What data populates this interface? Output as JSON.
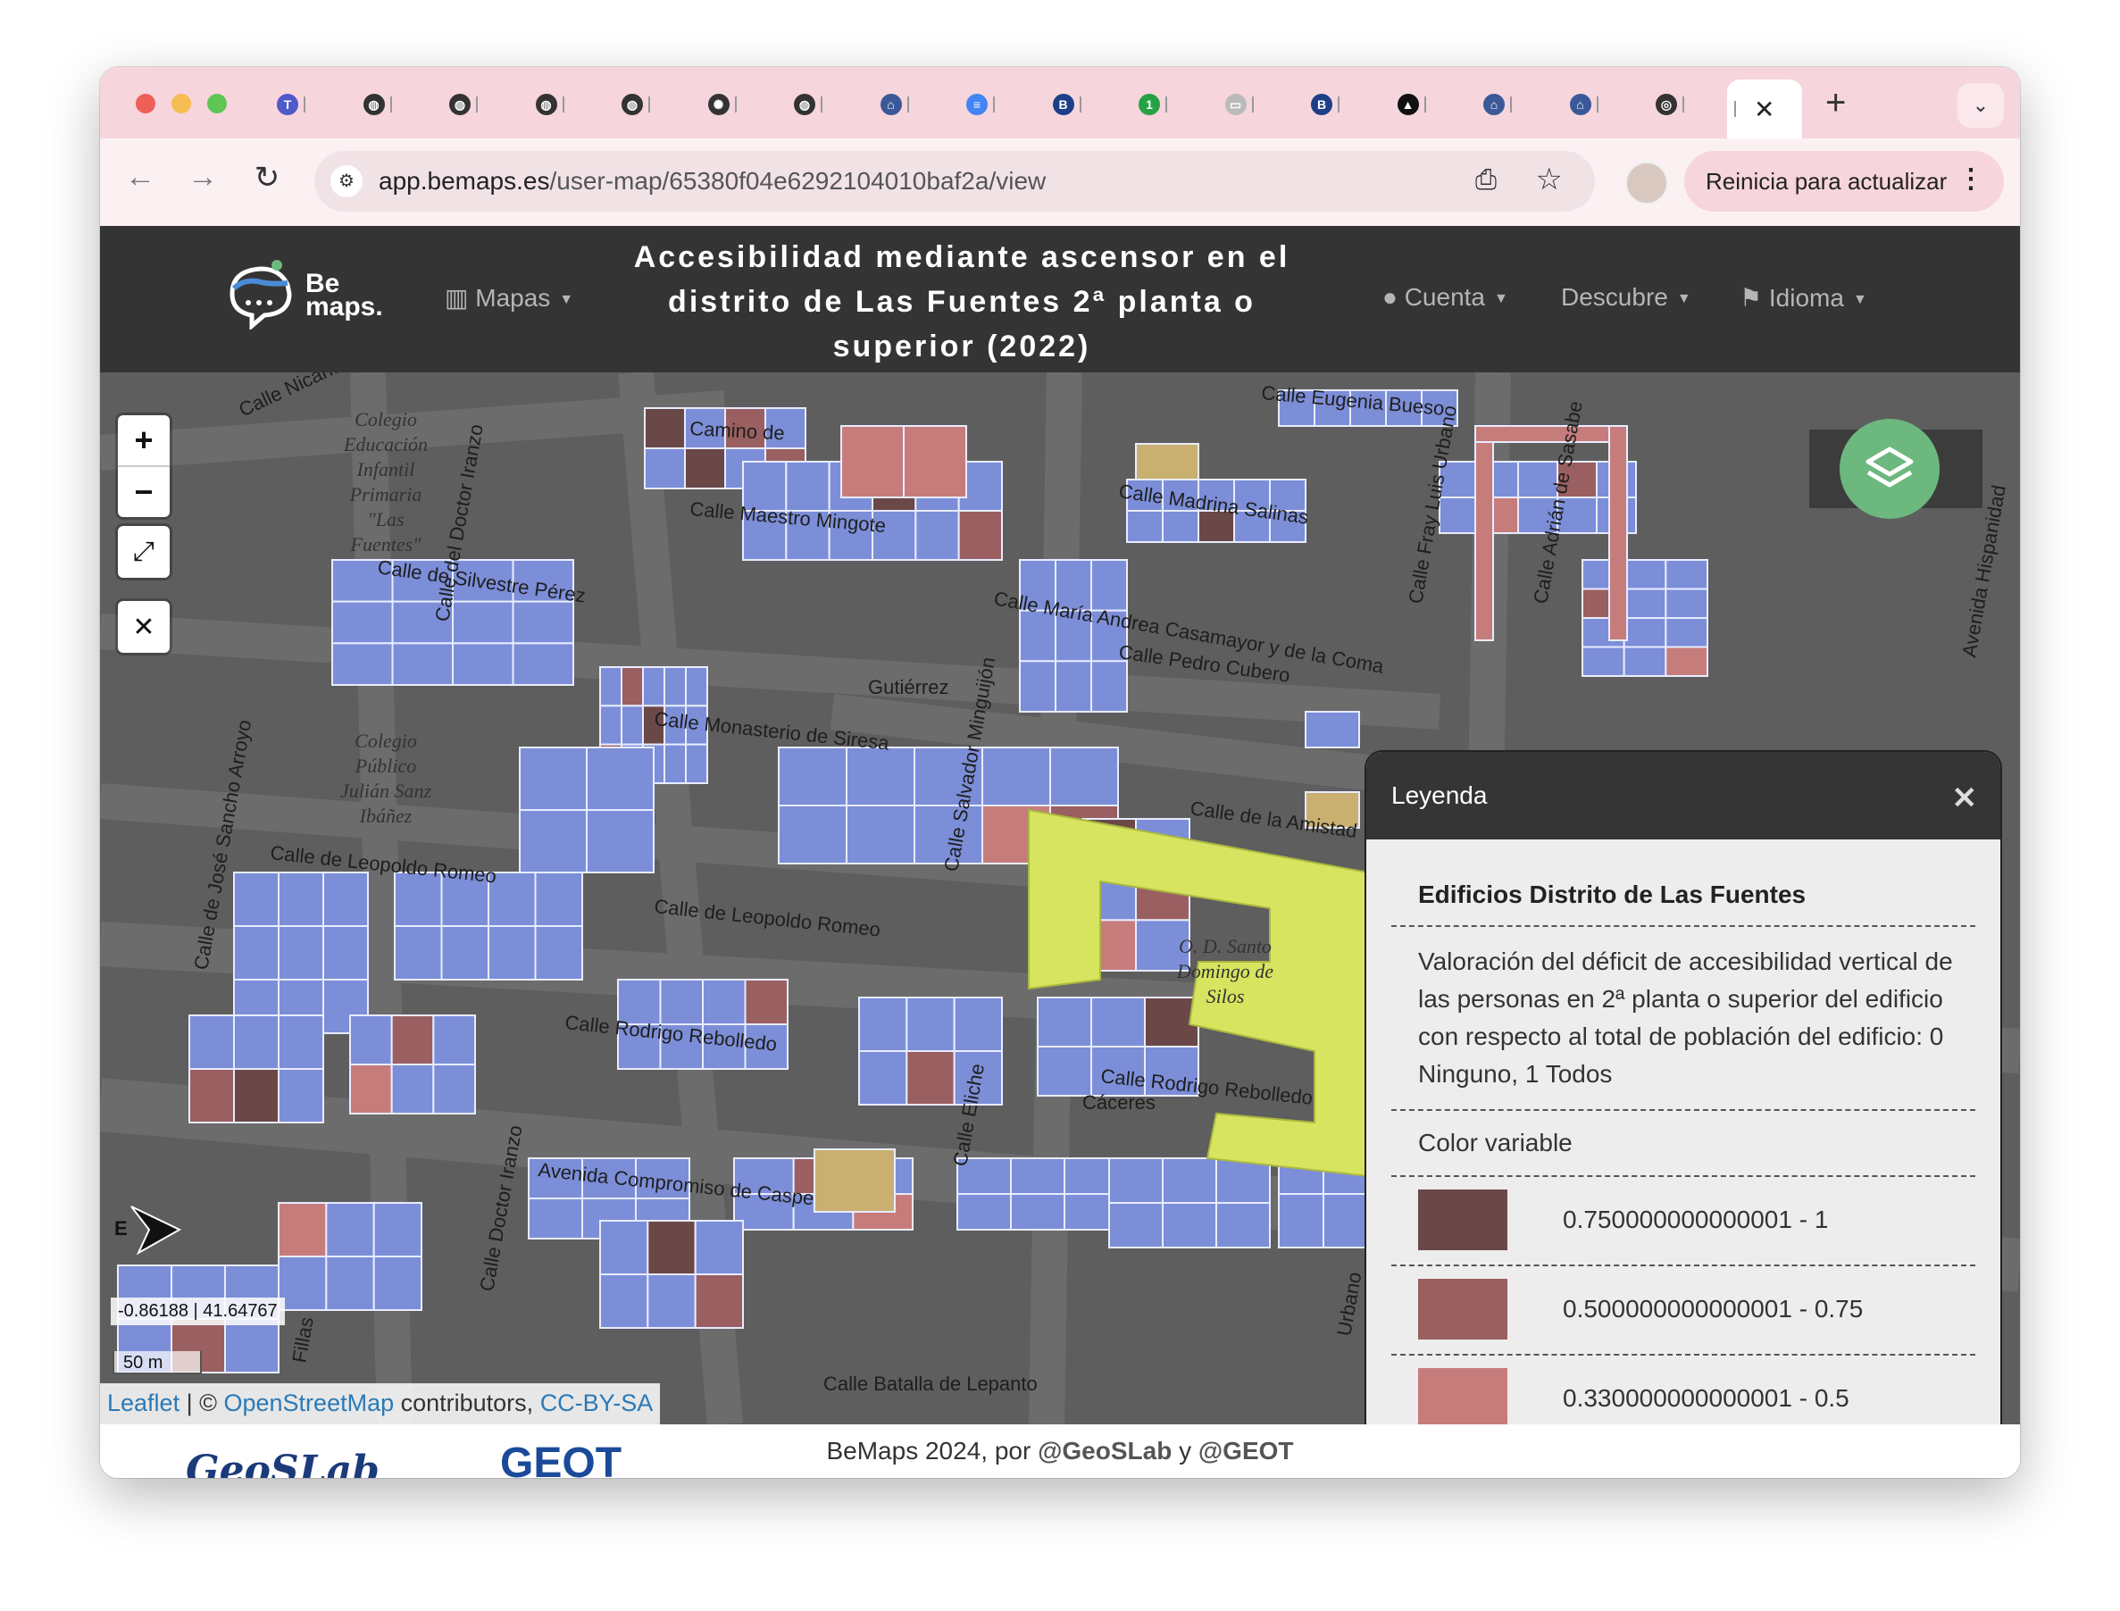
{
  "browser": {
    "tabs": [
      {
        "icon": "teams-icon",
        "color": "#5059c9",
        "glyph": "T"
      },
      {
        "icon": "globe-icon",
        "color": "#333333",
        "glyph": "◍"
      },
      {
        "icon": "globe-icon",
        "color": "#333333",
        "glyph": "◍"
      },
      {
        "icon": "globe-icon",
        "color": "#333333",
        "glyph": "◍"
      },
      {
        "icon": "globe-icon",
        "color": "#333333",
        "glyph": "◍"
      },
      {
        "icon": "chatgpt-icon",
        "color": "#333333",
        "glyph": "✺"
      },
      {
        "icon": "globe-icon",
        "color": "#333333",
        "glyph": "◍"
      },
      {
        "icon": "institution-icon",
        "color": "#3b5998",
        "glyph": "⌂"
      },
      {
        "icon": "docs-icon",
        "color": "#4285f4",
        "glyph": "≡"
      },
      {
        "icon": "boe-icon",
        "color": "#1d3f8a",
        "glyph": "B"
      },
      {
        "icon": "whatsapp-icon",
        "color": "#25a244",
        "glyph": "1"
      },
      {
        "icon": "document-icon",
        "color": "#bbbbbb",
        "glyph": "▭"
      },
      {
        "icon": "boe-icon",
        "color": "#1d3f8a",
        "glyph": "B"
      },
      {
        "icon": "graduation-icon",
        "color": "#111111",
        "glyph": "▲"
      },
      {
        "icon": "institution-icon",
        "color": "#3b5998",
        "glyph": "⌂"
      },
      {
        "icon": "institution-icon",
        "color": "#3b5998",
        "glyph": "⌂"
      },
      {
        "icon": "bemaps-icon",
        "color": "#333333",
        "glyph": "◎"
      }
    ],
    "active_tab_close": "✕",
    "new_tab": "+",
    "tab_menu": "⌄",
    "url_host": "app.bemaps.es",
    "url_path": "/user-map/65380f04e6292104010baf2a/view",
    "restart_label": "Reinicia para actualizar"
  },
  "app": {
    "logo_line1": "Be",
    "logo_line2": "maps.",
    "nav_maps": "Mapas",
    "map_title": "Accesibilidad mediante ascensor en el distrito de Las Fuentes 2ª planta o superior (2022)",
    "nav_account": "Cuenta",
    "nav_discover": "Descubre",
    "nav_language": "Idioma"
  },
  "map": {
    "zoom_in": "+",
    "zoom_out": "−",
    "fullscreen": "⤢",
    "fit": "✕",
    "compass_label": "E",
    "coordinates": "-0.86188 | 41.64767",
    "scale": "50 m",
    "attribution": {
      "leaflet": "Leaflet",
      "sep": " | © ",
      "osm": "OpenStreetMap",
      "contrib": " contributors, ",
      "license": "CC-BY-SA"
    },
    "street_labels": [
      "Calle Nicanor Villa",
      "Camino de",
      "Calle Maestro Mingote",
      "Calle de Silvestre Pérez",
      "Calle Madrina Salinas",
      "Calle Eugenia Bueso",
      "Calle María Andrea Casamayor y de la Coma",
      "Calle Pedro Cubero",
      "Calle Monasterio de Siresa",
      "Calle de la Amistad",
      "Calle de Leopoldo Romeo",
      "Calle de Leopoldo Romeo",
      "Calle Rodrigo Rebolledo",
      "Calle Rodrigo Rebolledo",
      "Avenida Compromiso de Caspe",
      "Calle Batalla de Lepanto",
      "Calle del Doctor Iranzo",
      "Calle Salvador Minguijón",
      "Calle de José Sancho Arroyo",
      "Calle Fray Luis Urbano",
      "Calle Adrián de Sasabe",
      "Avenida Hispanidad",
      "Calle Eliche",
      "Calle Doctor Iranzo",
      "Urbano",
      "Cáceres",
      "Gutiérrez",
      "Fillas"
    ],
    "place_labels": [
      "Colegio Educación Infantil Primaria \"Las Fuentes\"",
      "Colegio Público Julián Sanz Ibáñez",
      "O. D. Santo Domingo de Silos"
    ]
  },
  "legend": {
    "title": "Leyenda",
    "close": "✕",
    "layer_name": "Edificios Distrito de Las Fuentes",
    "description": "Valoración del déficit de accesibilidad vertical de las personas en 2ª planta o superior del edificio con respecto al total de población del edificio: 0 Ninguno, 1 Todos",
    "color_variable": "Color variable",
    "classes": [
      {
        "label": "0.750000000000001 - 1",
        "color": "#6b4848"
      },
      {
        "label": "0.500000000000001 - 0.75",
        "color": "#9a5f60"
      },
      {
        "label": "0.330000000000001 - 0.5",
        "color": "#c77c7c"
      },
      {
        "label": "",
        "color": "#c79a70"
      }
    ]
  },
  "footer": {
    "prefix": "BeMaps 2024, por ",
    "handle1": "@GeoSLab",
    "mid": " y ",
    "handle2": "@GEOT",
    "logo1": "GeoSLab",
    "logo2": "GEOT"
  }
}
